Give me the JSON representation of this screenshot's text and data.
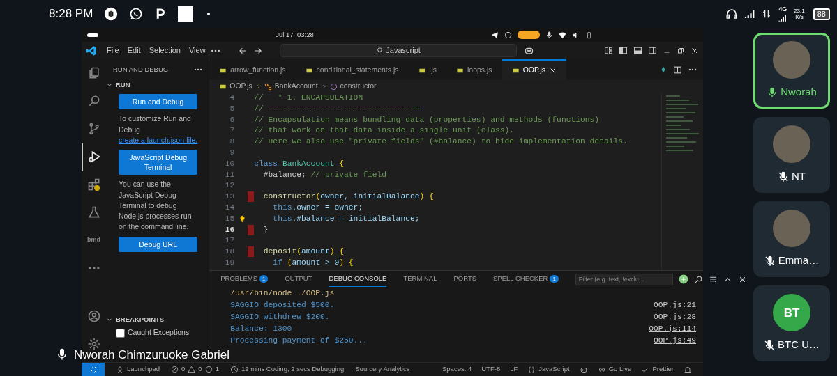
{
  "phone_status": {
    "time": "8:28 PM",
    "network": "4G",
    "speed": "23.1",
    "speed_unit": "K/s",
    "battery": "88"
  },
  "desktop_bar": {
    "clock": "Jul 17  03:28"
  },
  "vscode": {
    "menu": [
      "File",
      "Edit",
      "Selection",
      "View"
    ],
    "search": "Javascript",
    "sidebar": {
      "title": "RUN AND DEBUG",
      "section": "RUN",
      "run_button": "Run and Debug",
      "customize_text": "To customize Run and Debug",
      "customize_link": "create a launch.json file.",
      "terminal_button": "JavaScript Debug Terminal",
      "terminal_text": "You can use the JavaScript Debug Terminal to debug Node.js processes run on the command line.",
      "url_button": "Debug URL",
      "breakpoints_title": "BREAKPOINTS",
      "breakpoints": [
        {
          "label": "Caught Exceptions",
          "checked": false
        }
      ]
    },
    "activity": [
      {
        "selected": false
      },
      {
        "selected": false
      },
      {
        "selected": false
      },
      {
        "selected": true
      },
      {
        "selected": false
      },
      {
        "selected": false
      },
      {
        "label": "bmd",
        "selected": false
      },
      {
        "selected": false
      }
    ],
    "tabs": [
      {
        "label": "arrow_function.js",
        "selected": false
      },
      {
        "label": "conditional_statements.js",
        "selected": false
      },
      {
        "label": ".js",
        "selected": false
      },
      {
        "label": "loops.js",
        "selected": false
      },
      {
        "label": "OOP.js",
        "selected": true
      }
    ],
    "breadcrumb": [
      "OOP.js",
      "BankAccount",
      "constructor"
    ],
    "code": [
      {
        "n": "4",
        "current": false,
        "marked": false,
        "bulb": false,
        "tokens": [
          {
            "text": "//   * 1. ENCAPSULATION",
            "kind": "comment"
          }
        ]
      },
      {
        "n": "5",
        "current": false,
        "marked": false,
        "bulb": false,
        "tokens": [
          {
            "text": "// ================================",
            "kind": "comment"
          }
        ]
      },
      {
        "n": "6",
        "current": false,
        "marked": false,
        "bulb": false,
        "tokens": [
          {
            "text": "// Encapsulation means bundling data (properties) and methods (functions)",
            "kind": "comment"
          }
        ]
      },
      {
        "n": "7",
        "current": false,
        "marked": false,
        "bulb": false,
        "tokens": [
          {
            "text": "// that work on that data inside a single unit (class).",
            "kind": "comment"
          }
        ]
      },
      {
        "n": "8",
        "current": false,
        "marked": false,
        "bulb": false,
        "tokens": [
          {
            "text": "// Here we also use \"private fields\" (#balance) to hide implementation details.",
            "kind": "comment"
          }
        ]
      },
      {
        "n": "9",
        "current": false,
        "marked": false,
        "bulb": false
      },
      {
        "n": "10",
        "current": false,
        "marked": false,
        "bulb": false,
        "tokens": [
          {
            "text": "class ",
            "kind": "keyword"
          },
          {
            "text": "BankAccount ",
            "kind": "type"
          },
          {
            "text": "{",
            "kind": "brace"
          }
        ]
      },
      {
        "n": "11",
        "current": false,
        "marked": false,
        "bulb": false,
        "tokens": [
          {
            "text": "  #balance; ",
            "kind": "plain"
          },
          {
            "text": "// private field",
            "kind": "comment"
          }
        ]
      },
      {
        "n": "12",
        "current": false,
        "marked": false,
        "bulb": false
      },
      {
        "n": "13",
        "current": false,
        "marked": true,
        "bulb": false,
        "tokens": [
          {
            "text": "  constructor",
            "kind": "func"
          },
          {
            "text": "(",
            "kind": "brace"
          },
          {
            "text": "owner, initialBalance",
            "kind": "var"
          },
          {
            "text": ") {",
            "kind": "brace"
          }
        ]
      },
      {
        "n": "14",
        "current": false,
        "marked": false,
        "bulb": false,
        "tokens": [
          {
            "text": "    this",
            "kind": "keyword"
          },
          {
            "text": ".owner = owner;",
            "kind": "var"
          }
        ]
      },
      {
        "n": "15",
        "current": false,
        "marked": false,
        "bulb": true,
        "tokens": [
          {
            "text": "    this",
            "kind": "keyword"
          },
          {
            "text": ".#balance = initialBalance;",
            "kind": "var"
          }
        ]
      },
      {
        "n": "16",
        "current": true,
        "marked": true,
        "bulb": false,
        "tokens": [
          {
            "text": "  }",
            "kind": "plain"
          }
        ]
      },
      {
        "n": "17",
        "current": false,
        "marked": false,
        "bulb": false
      },
      {
        "n": "18",
        "current": false,
        "marked": true,
        "bulb": false,
        "tokens": [
          {
            "text": "  deposit",
            "kind": "func"
          },
          {
            "text": "(",
            "kind": "brace"
          },
          {
            "text": "amount",
            "kind": "var"
          },
          {
            "text": ") {",
            "kind": "brace"
          }
        ]
      },
      {
        "n": "19",
        "current": false,
        "marked": false,
        "bulb": false,
        "tokens": [
          {
            "text": "    if ",
            "kind": "keyword"
          },
          {
            "text": "(",
            "kind": "brace"
          },
          {
            "text": "amount > 0",
            "kind": "var"
          },
          {
            "text": ") {",
            "kind": "brace"
          }
        ]
      }
    ],
    "panel": {
      "tabs": [
        {
          "label": "PROBLEMS",
          "badge": "1",
          "selected": false
        },
        {
          "label": "OUTPUT",
          "selected": false
        },
        {
          "label": "DEBUG CONSOLE",
          "selected": true
        },
        {
          "label": "TERMINAL",
          "selected": false
        },
        {
          "label": "PORTS",
          "selected": false
        },
        {
          "label": "SPELL CHECKER",
          "badge": "1",
          "selected": false
        }
      ],
      "filter_placeholder": "Filter (e.g. text, !exclu...",
      "lines": [
        {
          "kind": "command",
          "text": "/usr/bin/node ./OOP.js"
        },
        {
          "kind": "log",
          "text": "SAGGIO deposited $500.",
          "source": "OOP.js:21"
        },
        {
          "kind": "log",
          "text": "SAGGIO withdrew $200.",
          "source": "OOP.js:28"
        },
        {
          "kind": "log",
          "text": "Balance: 1300",
          "source": "OOP.js:114"
        },
        {
          "kind": "log",
          "text": "Processing payment of $250...",
          "source": "OOP.js:49"
        }
      ]
    },
    "status_left": [
      {
        "kind": "text",
        "text": "Launchpad"
      },
      {
        "kind": "counts",
        "errors": "0",
        "warnings": "0",
        "infos": "1"
      },
      {
        "kind": "text",
        "text": "12 mins Coding, 2 secs Debugging"
      },
      {
        "kind": "text",
        "text": "Sourcery Analytics"
      }
    ],
    "status_right": [
      {
        "kind": "text",
        "text": "Spaces: 4"
      },
      {
        "kind": "text",
        "text": "UTF-8"
      },
      {
        "kind": "text",
        "text": "LF"
      },
      {
        "kind": "text",
        "text": "JavaScript"
      },
      {
        "kind": "text",
        "text": "Go Live"
      },
      {
        "kind": "text",
        "text": "Prettier"
      }
    ]
  },
  "presenter": {
    "name": "Nworah Chimzuruoke Gabriel"
  },
  "participants": [
    {
      "name": "Nworah",
      "speaking": true,
      "muted": false,
      "kind": "photo"
    },
    {
      "name": "NT",
      "speaking": false,
      "muted": true,
      "kind": "photo"
    },
    {
      "name": "Emma…",
      "speaking": false,
      "muted": true,
      "kind": "photo"
    },
    {
      "name": "BTC U…",
      "speaking": false,
      "muted": true,
      "kind": "initials",
      "initials": "BT"
    }
  ]
}
